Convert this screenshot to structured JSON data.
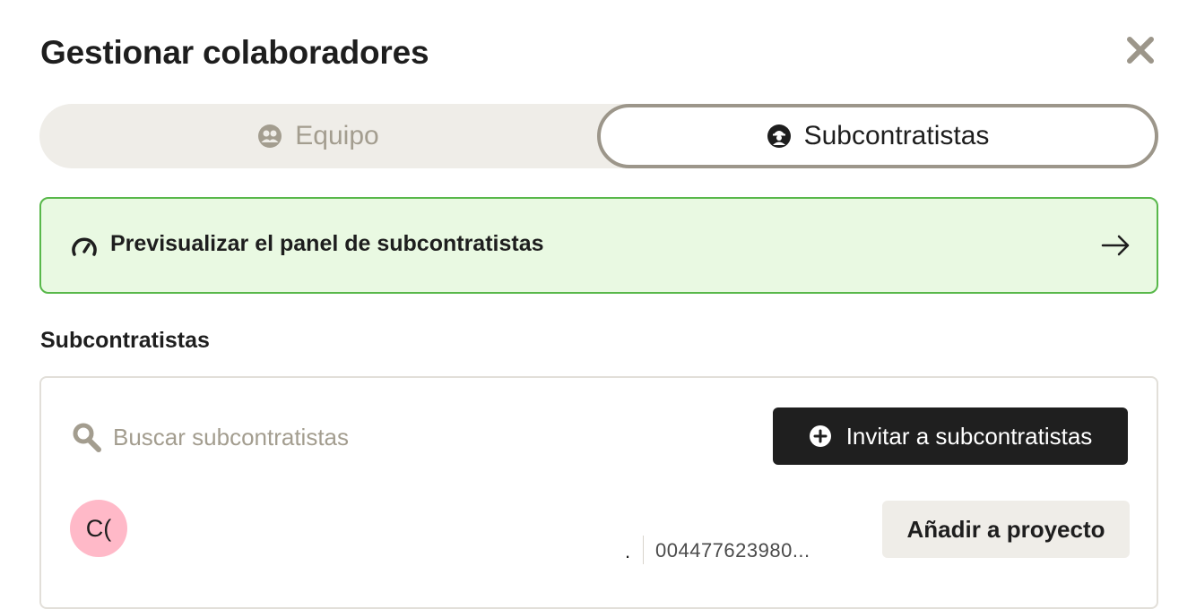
{
  "dialog": {
    "title": "Gestionar colaboradores",
    "close_icon": "close-icon"
  },
  "tabs": [
    {
      "label": "Equipo",
      "icon": "team-icon",
      "active": false
    },
    {
      "label": "Subcontratistas",
      "icon": "subcontractor-icon",
      "active": true
    }
  ],
  "banner": {
    "text": "Previsualizar el panel de subcontratistas",
    "icon": "gauge-icon",
    "arrow_icon": "arrow-right-icon"
  },
  "section": {
    "label": "Subcontratistas"
  },
  "search": {
    "placeholder": "Buscar subcontratistas",
    "value": ""
  },
  "invite_button": {
    "label": "Invitar a subcontratistas",
    "icon": "plus-circle-icon"
  },
  "subcontractors": [
    {
      "initials": "C(",
      "separator": ".",
      "phone": "004477623980...",
      "action_label": "Añadir a proyecto"
    }
  ],
  "colors": {
    "banner_bg": "#e9f9e2",
    "banner_border": "#58b84a",
    "avatar_bg": "#ffb9c8",
    "primary_button": "#1f1f1f",
    "muted_text": "#a39d8f"
  }
}
